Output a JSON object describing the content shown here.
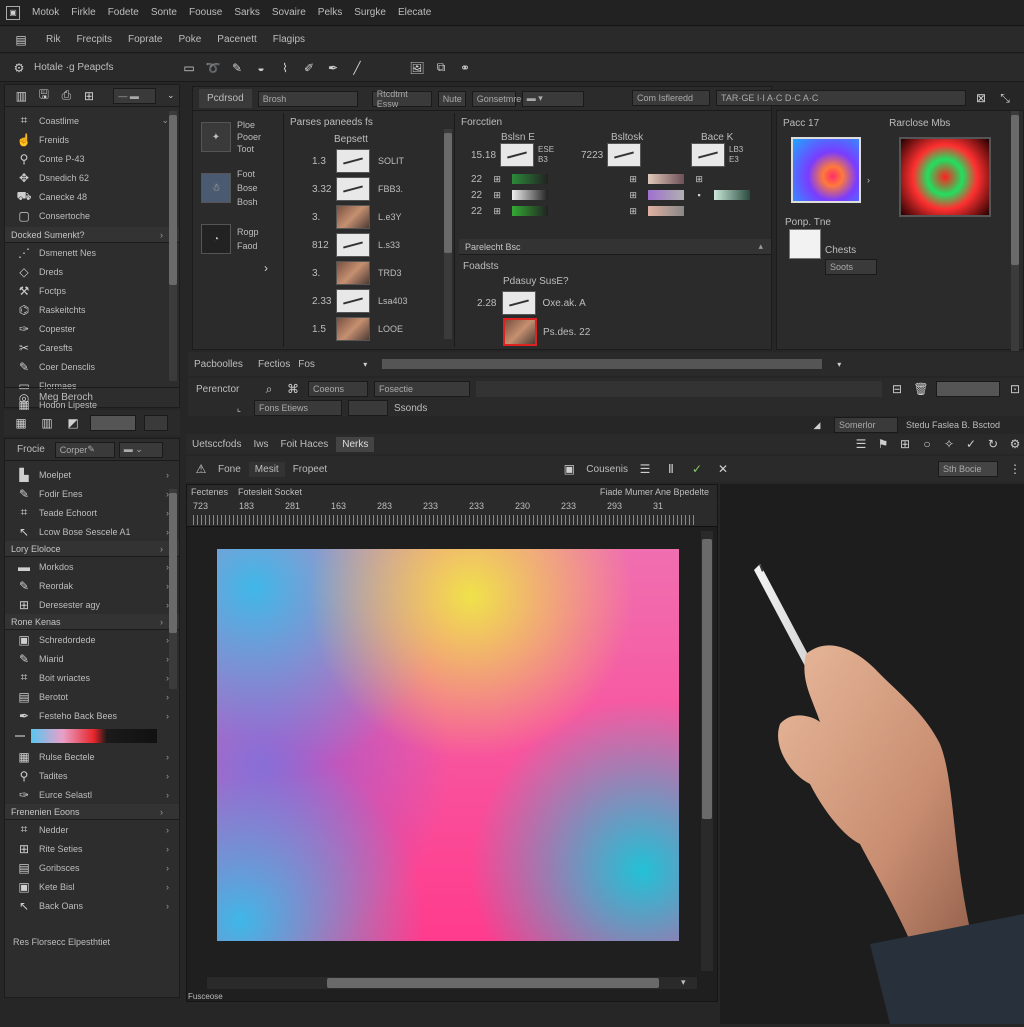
{
  "menubar": {
    "items": [
      "Motok",
      "Firkle",
      "Fodete",
      "Sonte",
      "Foouse",
      "Sarks",
      "Sovaire",
      "Pelks",
      "Surgke",
      "Elecate"
    ]
  },
  "toolbar1": {
    "items": [
      "Rik",
      "Frecpits",
      "Foprate",
      "Poke",
      "Pacenett",
      "Flagips"
    ]
  },
  "toolbar2": {
    "label": "Hotale ·g Peapcfs"
  },
  "left_top": {
    "items": [
      "Coastlime",
      "Frenids",
      "Conte P-43",
      "Dsnedich 62",
      "Canecke 48",
      "Consertoche"
    ],
    "section": "Docked Sumenkt?",
    "items2": [
      "Dsmenett Nes",
      "Dreds",
      "Foctps",
      "Raskeitchts",
      "Copester",
      "Caresfts",
      "Coer Densclis",
      "Flormaes",
      "Hodon Lipeste"
    ],
    "footer": "Meg Beroch"
  },
  "left_bottom": {
    "tabs": [
      "Frocie",
      "Corper"
    ],
    "items": [
      "Moelpet",
      "Fodir Enes",
      "Teade Echoort",
      "Lcow Bose Sescele A1"
    ],
    "section1": "Lory Eloloce",
    "items2": [
      "Morkdos",
      "Reordak",
      "Deresester agy"
    ],
    "section2": "Rone Kenas",
    "items3": [
      "Schredordede",
      "Miarid",
      "Boit wriactes",
      "Berotot",
      "Festeho Back Bees"
    ],
    "items4": [
      "Rulse Bectele",
      "Tadites",
      "Eurce Selastl"
    ],
    "section3": "Frenenien Eoons",
    "items5": [
      "Nedder",
      "Rite Seties",
      "Goribsces",
      "Kete Bisl",
      "Back Oans"
    ],
    "footer": "Res Florsecc Elpesthtiet"
  },
  "props": {
    "tab": "Pcdrsod",
    "tabfield": "Brosh",
    "right_tabs": [
      "Rtcdtmt Essw",
      "Nute",
      "Gonsetmre"
    ],
    "search_label": "Com Isfleredd",
    "path_field": "TAR·GE I·I A·C D·C A·C",
    "icon_labels": [
      "Ploe",
      "Pooer",
      "Toot",
      "Foot",
      "Bose",
      "Bosh",
      "Rogp",
      "Faod"
    ],
    "layers_title": "Parses paneeds fs",
    "layers_sub": "Bepsett",
    "layers": [
      {
        "n": "1.3",
        "t": "SOLIT"
      },
      {
        "n": "3.32",
        "t": "FBB3."
      },
      {
        "n": "3.",
        "t": "L.e3Y"
      },
      {
        "n": "812",
        "t": "L.s33"
      },
      {
        "n": "3.",
        "t": "TRD3"
      },
      {
        "n": "2.33",
        "t": "Lsa403"
      },
      {
        "n": "1.5",
        "t": "LOOE"
      }
    ],
    "fx_title": "Forcctien",
    "fx_cols": [
      {
        "head": "Bslsn E",
        "num": "15.18",
        "t1": "ESE",
        "t2": "B3"
      },
      {
        "head": "Bsltosk",
        "num": "7223",
        "t1": "",
        "t2": ""
      },
      {
        "head": "Bace K",
        "num": "",
        "t1": "LB3",
        "t2": "E3"
      }
    ],
    "fx_rows": [
      "22",
      "22",
      "22"
    ],
    "divider_label": "Parelecht Bsc",
    "lower_label": "Foadsts",
    "lower_title": "Pdasuy SusE?",
    "lower_items": [
      {
        "n": "2.28",
        "t": "Oxe.ak. A"
      },
      {
        "n": "",
        "t": "Ps.des. 22"
      }
    ],
    "color_title": "Pacc 17",
    "color_title2": "Rarclose Mbs",
    "color_label": "Ponp. Tne",
    "color_label2": "Chests",
    "color_value": "Soots"
  },
  "bar3": {
    "label": "Pacboolles",
    "tab": "Fectios",
    "tab2": "Fos"
  },
  "bar4": {
    "label": "Perenctor",
    "f1": "Coeons",
    "f2": "Fosectie",
    "f3": "Fons Etiews",
    "f4": "Ssonds"
  },
  "bar5": {
    "field": "Somerlor",
    "right": "Stedu Faslea B. Bsctod"
  },
  "canvas_tabs": [
    "Uetsccfods",
    "Iws",
    "Foit Haces",
    "Nerks"
  ],
  "canvas_toolbar": {
    "b1": "Fone",
    "b2": "Mesit",
    "b3": "Fropeet",
    "right": "Cousenis",
    "btn": "Sth Bocie"
  },
  "canvas_header": {
    "left": "Fectenes",
    "mid": "Fotesleit Socket",
    "right": "Fiade Mumer Ane Bpedelte"
  },
  "ruler": [
    "723",
    "183",
    "281",
    "163",
    "283",
    "233",
    "233",
    "230",
    "233",
    "293",
    "31"
  ],
  "status": "Fusceose",
  "gradient": {
    "colors": [
      "#3fb7e8",
      "#f0e24a",
      "#ff3b8d",
      "#9c5ad3",
      "#22c1d6"
    ]
  }
}
